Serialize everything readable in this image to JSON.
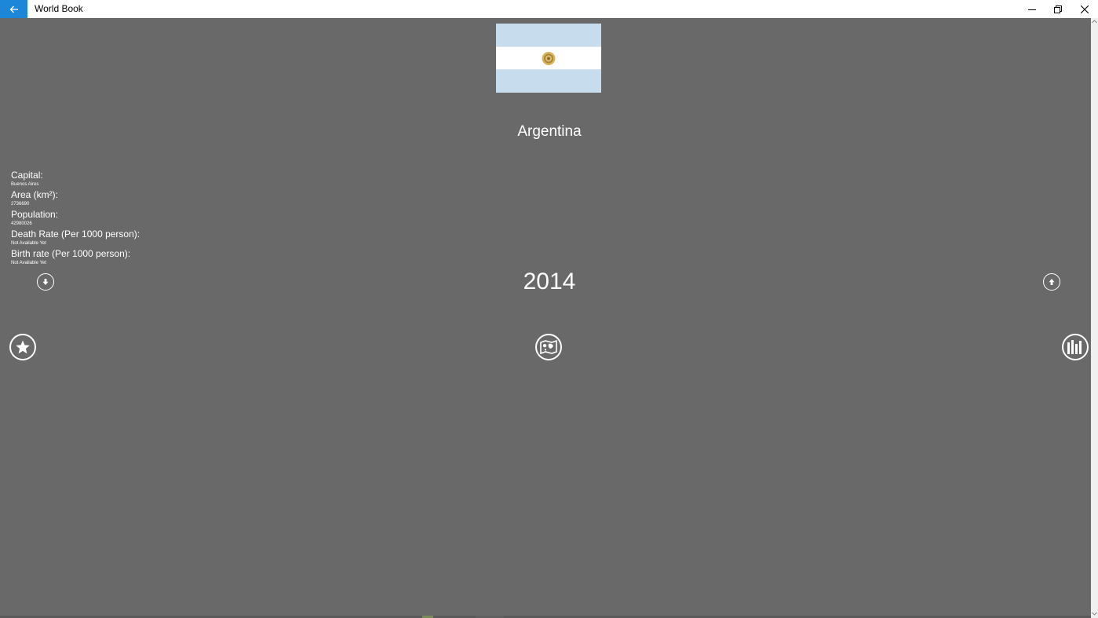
{
  "window": {
    "title": "World Book"
  },
  "country": {
    "name": "Argentina",
    "flag_colors": {
      "light_blue": "#c7dced",
      "white": "#ffffff",
      "sun": "#c9a23a"
    }
  },
  "info": {
    "capital_label": "Capital:",
    "capital_value": "Buenos Aires",
    "area_label": "Area (km²):",
    "area_value": "2736690",
    "population_label": "Population:",
    "population_value": "42980026",
    "death_rate_label": "Death Rate (Per 1000 person):",
    "death_rate_value": "Not Available Yet",
    "birth_rate_label": "Birth rate (Per 1000 person):",
    "birth_rate_value": "Not Available Yet"
  },
  "year": "2014",
  "icons": {
    "back": "arrow-left-icon",
    "minimize": "minimize-icon",
    "maximize": "restore-icon",
    "close": "close-icon",
    "year_down": "arrow-down-circle-icon",
    "year_up": "arrow-up-circle-icon",
    "favorite": "star-icon",
    "map": "map-icon",
    "chart": "bar-chart-icon"
  },
  "colors": {
    "accent": "#1c86d8",
    "background": "#696969",
    "text": "#ffffff"
  }
}
